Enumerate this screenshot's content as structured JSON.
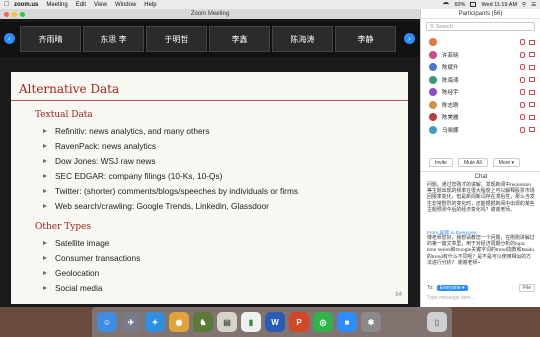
{
  "menubar": {
    "apple": "",
    "items": [
      "zoom.us",
      "Meeting",
      "Edit",
      "View",
      "Window",
      "Help"
    ],
    "battery": "60%",
    "clock": "Wed 11:19 AM"
  },
  "zoom_window": {
    "title": "Zoom Meeting",
    "gallery": [
      "齐雨晴",
      "东思 李",
      "于明哲",
      "李鑫",
      "陈海涛",
      "李静"
    ]
  },
  "slide": {
    "title": "Alternative Data",
    "sections": [
      {
        "heading": "Textual Data",
        "items": [
          "Refinitiv: news analytics, and many others",
          "RavenPack: news analytics",
          "Dow Jones: WSJ raw news",
          "SEC EDGAR: company filings (10-Ks, 10-Qs)",
          "Twitter: (shorter) comments/blogs/speeches by individuals or firms",
          "Web search/crawling: Google Trends, Linkedin, Glassdoor"
        ]
      },
      {
        "heading": "Other Types",
        "items": [
          "Satellite image",
          "Consumer transactions",
          "Geolocation",
          "Social media"
        ]
      }
    ],
    "page_number": "84"
  },
  "participants": {
    "title": "Participants (56)",
    "search_placeholder": "Search",
    "people": [
      {
        "name": "",
        "color": "#e7773b"
      },
      {
        "name": "许菲晓",
        "color": "#d04a8b"
      },
      {
        "name": "陈斌升",
        "color": "#4a77d0"
      },
      {
        "name": "陈海涛",
        "color": "#2e9e6b"
      },
      {
        "name": "陈经宇",
        "color": "#8b4ad0"
      },
      {
        "name": "陈志刚",
        "color": "#d0924a"
      },
      {
        "name": "陈美麗",
        "color": "#c23b3b"
      },
      {
        "name": "马晓娜",
        "color": "#3b9ec2"
      }
    ],
    "buttons": [
      "Invite",
      "Mute All",
      "More ▾"
    ]
  },
  "chat": {
    "title": "Chat",
    "message1": "问题。通过您刚才的讲解，发现新闻中recession等主题出现的频率在很大程度上可以解释股票市场回报率变化，但是新闻新词存在滞后性，那么当发生非常剧烈的变化时，还能根据新闻中出现的某些主题预测今后的经济变化吗？谢谢老师。",
    "from": "From 吴毓 to Everyone:",
    "message2": "傅老师您好，我想请教您一个问题，在刚刚讲解过的第一篇文章里，用于对经济周期分析的topic time series和Google关键字词的trend指数和Baidu的trend有什么不同呢？是不是可以使用相似的方法进行分析？ 谢谢老师~",
    "to_label": "To:",
    "to_value": "Everyone ▾",
    "file_button": "File",
    "input_placeholder": "Type message here..."
  },
  "dock": {
    "apps": [
      {
        "name": "finder-icon",
        "color": "#3f8de0",
        "glyph": "☺"
      },
      {
        "name": "launchpad-icon",
        "color": "#7a7a86",
        "glyph": "🚀"
      },
      {
        "name": "safari-icon",
        "color": "#2f8fe0",
        "glyph": "✦"
      },
      {
        "name": "chrome-icon",
        "color": "#e0a33b",
        "glyph": "◉"
      },
      {
        "name": "game-icon",
        "color": "#5a7a3a",
        "glyph": "♞"
      },
      {
        "name": "notes-icon",
        "color": "#d4d4c8",
        "glyph": "▤"
      },
      {
        "name": "charts-icon",
        "color": "#f0f0f0",
        "glyph": "▮"
      },
      {
        "name": "word-icon",
        "color": "#2b5cb5",
        "glyph": "W"
      },
      {
        "name": "powerpoint-icon",
        "color": "#d24726",
        "glyph": "P"
      },
      {
        "name": "wechat-icon",
        "color": "#2fb34a",
        "glyph": "◎"
      },
      {
        "name": "zoom-icon",
        "color": "#2d8cff",
        "glyph": "■"
      },
      {
        "name": "photos-icon",
        "color": "#8a8a8a",
        "glyph": "✱"
      },
      {
        "name": "trash-icon",
        "color": "#cfcfcf",
        "glyph": "🗑"
      }
    ]
  }
}
